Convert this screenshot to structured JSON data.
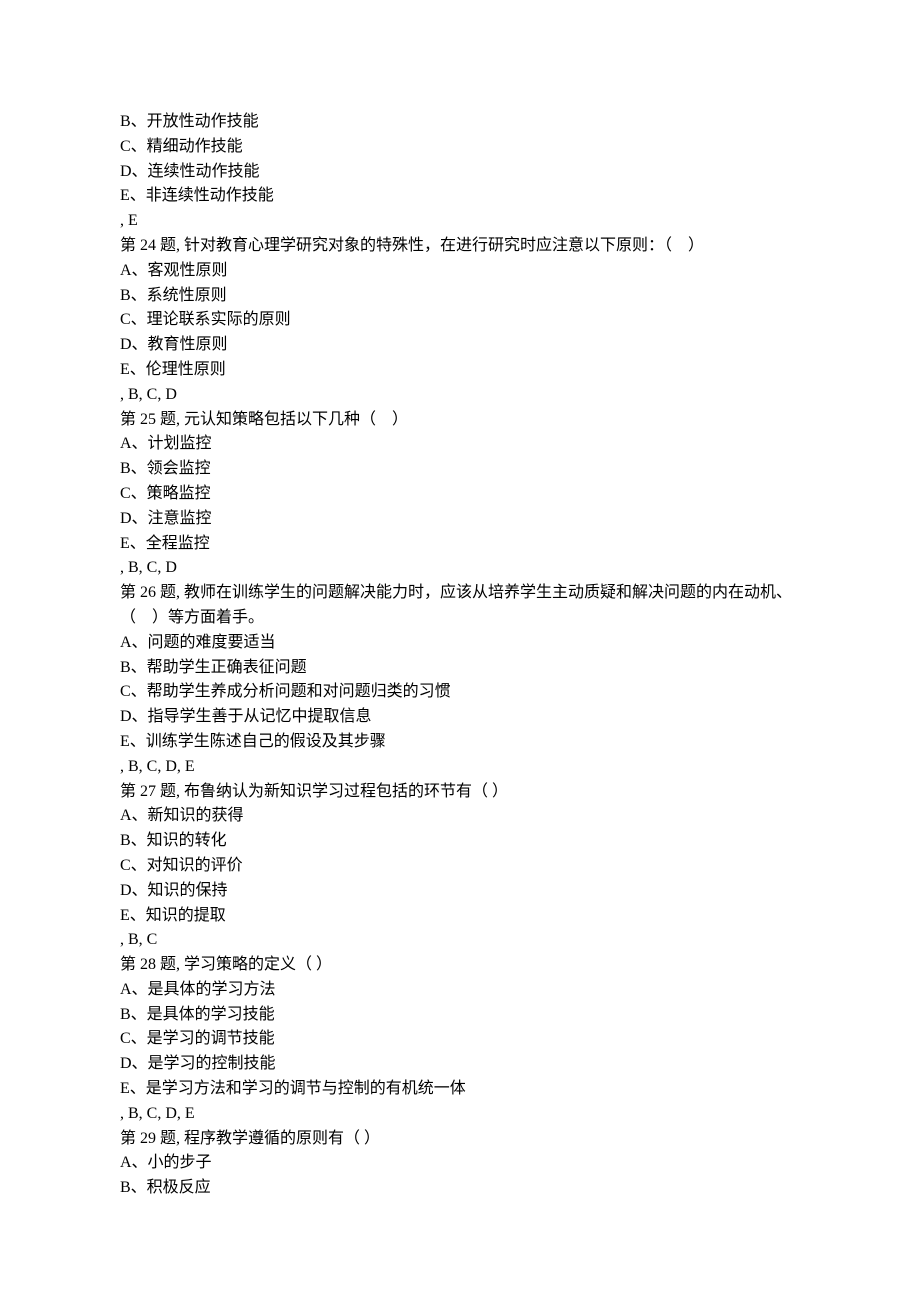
{
  "lines": [
    "B、开放性动作技能",
    "C、精细动作技能",
    "D、连续性动作技能",
    "E、非连续性动作技能",
    ", E",
    "第 24 题, 针对教育心理学研究对象的特殊性，在进行研究时应注意以下原则：（　）",
    "A、客观性原则",
    "B、系统性原则",
    "C、理论联系实际的原则",
    "D、教育性原则",
    "E、伦理性原则",
    ", B, C, D",
    "第 25 题, 元认知策略包括以下几种（　）",
    "A、计划监控",
    "B、领会监控",
    "C、策略监控",
    "D、注意监控",
    "E、全程监控",
    ", B, C, D",
    "第 26 题, 教师在训练学生的问题解决能力时，应该从培养学生主动质疑和解决问题的内在动机、（　）等方面着手。",
    "A、问题的难度要适当",
    "B、帮助学生正确表征问题",
    "C、帮助学生养成分析问题和对问题归类的习惯",
    "D、指导学生善于从记忆中提取信息",
    "E、训练学生陈述自己的假设及其步骤",
    ", B, C, D, E",
    "第 27 题, 布鲁纳认为新知识学习过程包括的环节有（ ）",
    "A、新知识的获得",
    "B、知识的转化",
    "C、对知识的评价",
    "D、知识的保持",
    "E、知识的提取",
    ", B, C",
    "第 28 题, 学习策略的定义（ ）",
    "A、是具体的学习方法",
    "B、是具体的学习技能",
    "C、是学习的调节技能",
    "D、是学习的控制技能",
    "E、是学习方法和学习的调节与控制的有机统一体",
    ", B, C, D, E",
    "第 29 题, 程序教学遵循的原则有（ ）",
    "A、小的步子",
    "B、积极反应"
  ]
}
